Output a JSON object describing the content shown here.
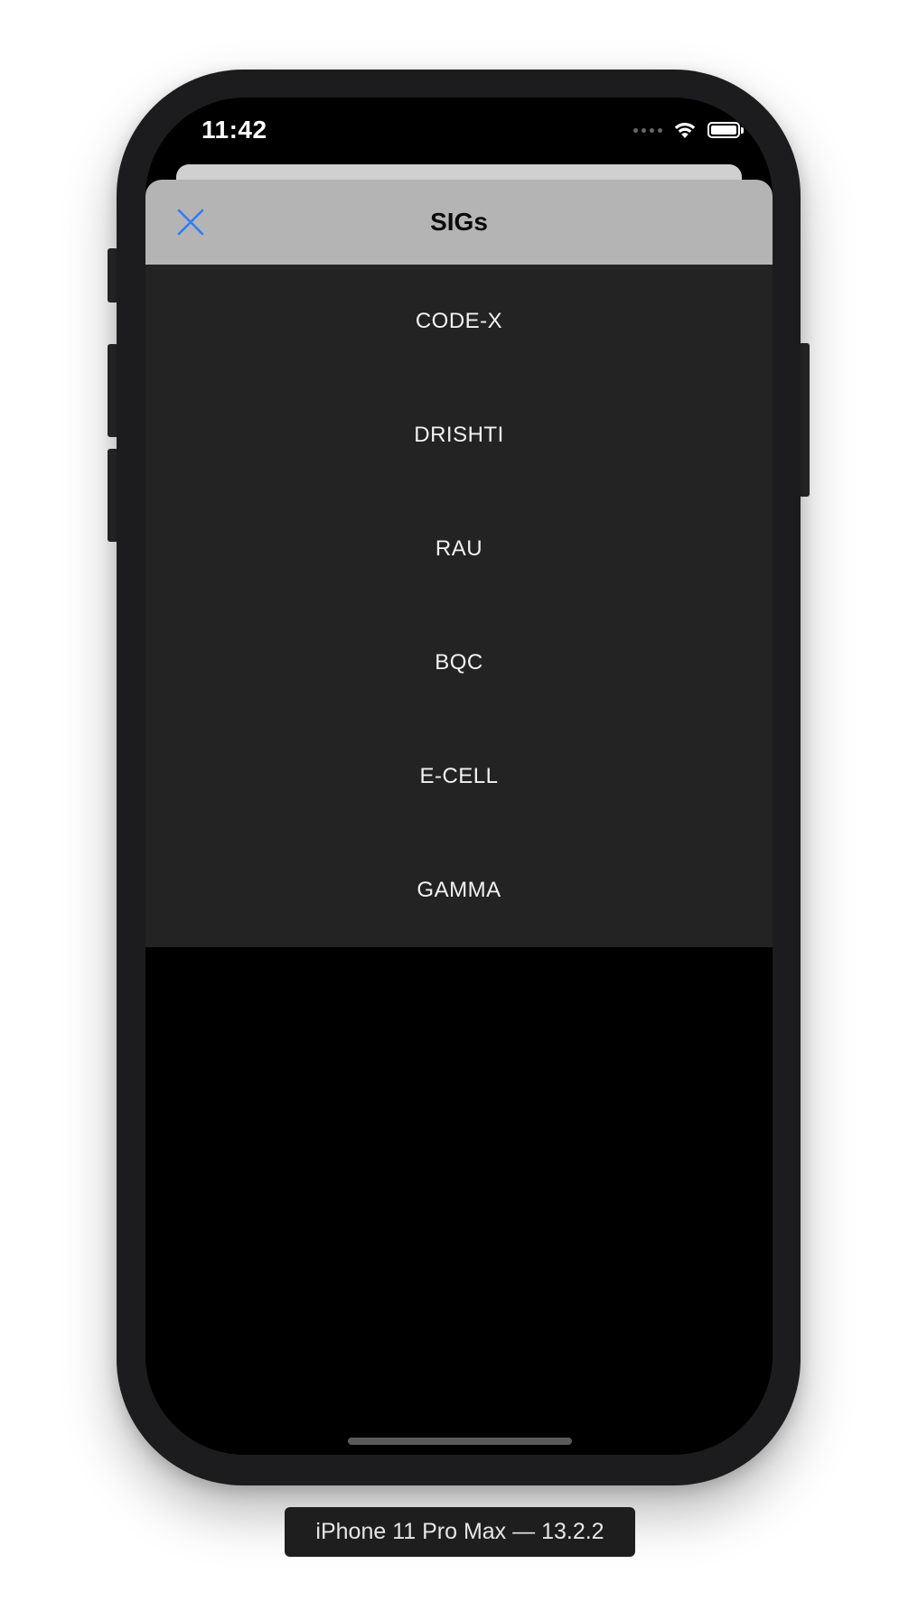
{
  "status_bar": {
    "time": "11:42"
  },
  "sheet": {
    "title": "SIGs",
    "close_icon": "close-x-icon",
    "accent_color": "#2f7cf6",
    "items": [
      {
        "label": "CODE-X"
      },
      {
        "label": "DRISHTI"
      },
      {
        "label": "RAU"
      },
      {
        "label": "BQC"
      },
      {
        "label": "E-CELL"
      },
      {
        "label": "GAMMA"
      }
    ]
  },
  "device": {
    "label": "iPhone 11 Pro Max — 13.2.2"
  },
  "colors": {
    "header_bg": "#b4b4b4",
    "list_bg": "#232323",
    "screen_bg": "#000000"
  }
}
